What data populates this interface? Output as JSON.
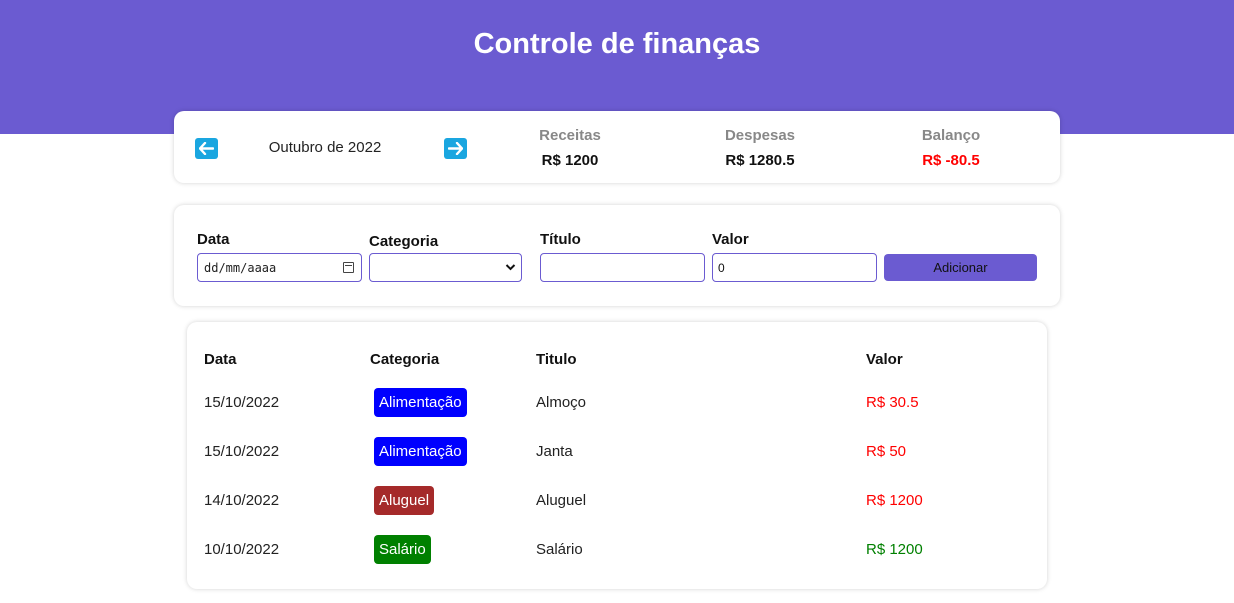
{
  "app": {
    "title": "Controle de finanças"
  },
  "info": {
    "month_label": "Outubro de 2022",
    "income": {
      "label": "Receitas",
      "value": "R$ 1200"
    },
    "expense": {
      "label": "Despesas",
      "value": "R$ 1280.5"
    },
    "balance": {
      "label": "Balanço",
      "value": "R$ -80.5",
      "color": "#ff0000"
    }
  },
  "form": {
    "date_label": "Data",
    "date_placeholder": "dd/mm/aaaa",
    "category_label": "Categoria",
    "category_value": "",
    "title_label": "Título",
    "title_value": "",
    "value_label": "Valor",
    "value_value": "0",
    "add_label": "Adicionar"
  },
  "table": {
    "headers": {
      "date": "Data",
      "category": "Categoria",
      "title": "Titulo",
      "value": "Valor"
    },
    "rows": [
      {
        "date": "15/10/2022",
        "category": "Alimentação",
        "category_color": "#0000ff",
        "title": "Almoço",
        "value": "R$ 30.5",
        "value_color": "#ff0000"
      },
      {
        "date": "15/10/2022",
        "category": "Alimentação",
        "category_color": "#0000ff",
        "title": "Janta",
        "value": "R$ 50",
        "value_color": "#ff0000"
      },
      {
        "date": "14/10/2022",
        "category": "Aluguel",
        "category_color": "#a52a2a",
        "title": "Aluguel",
        "value": "R$ 1200",
        "value_color": "#ff0000"
      },
      {
        "date": "10/10/2022",
        "category": "Salário",
        "category_color": "#008000",
        "title": "Salário",
        "value": "R$ 1200",
        "value_color": "#008000"
      }
    ]
  },
  "colors": {
    "accent": "#6b5bd1",
    "arrow_button": "#1aa6e0"
  },
  "icons": {
    "prev": "arrow-left-icon",
    "next": "arrow-right-icon",
    "calendar": "calendar-icon",
    "dropdown": "chevron-down-icon"
  }
}
